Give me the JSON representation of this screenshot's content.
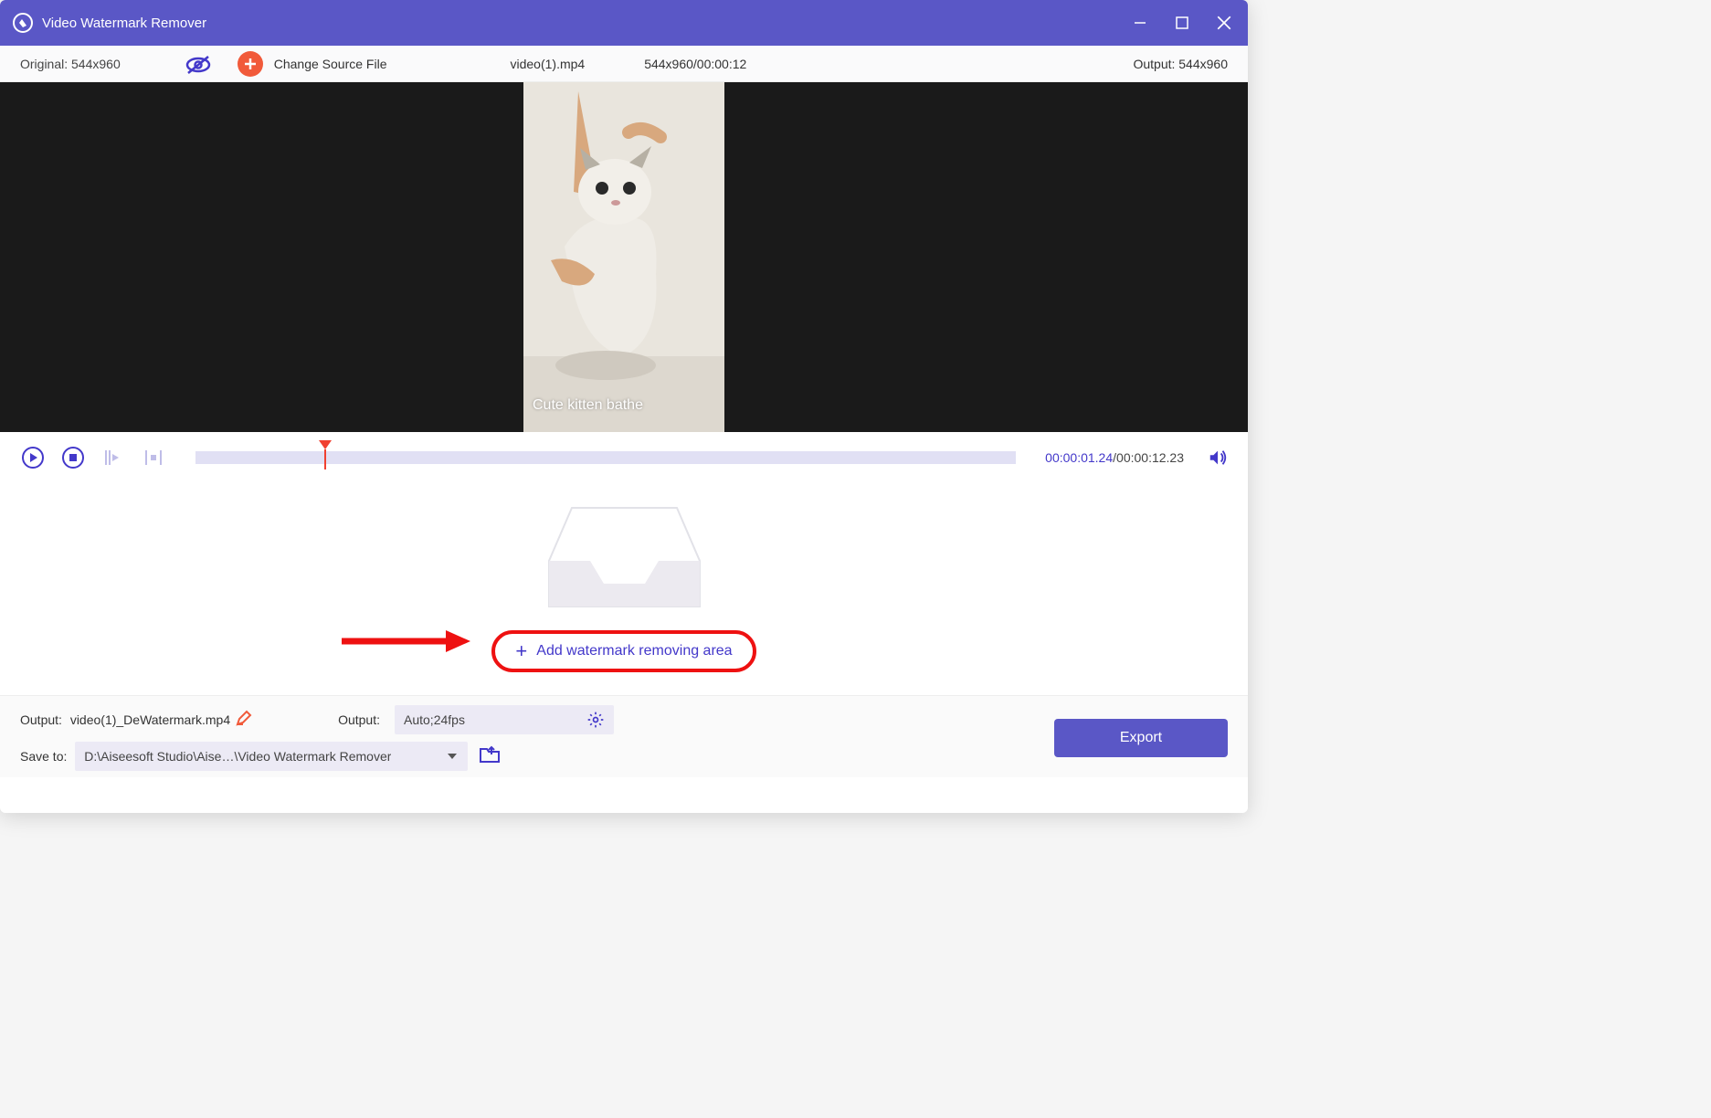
{
  "window": {
    "title": "Video Watermark Remover"
  },
  "infobar": {
    "original_label": "Original: 544x960",
    "change_source_label": "Change Source File",
    "filename": "video(1).mp4",
    "dimensions_time": "544x960/00:00:12",
    "output_label": "Output: 544x960"
  },
  "video": {
    "watermark_text": "Cute kitten bathe"
  },
  "player": {
    "current_time": "00:00:01.24",
    "total_time": "/00:00:12.23",
    "progress_percent": 15
  },
  "dropzone": {
    "button_label": "Add watermark removing area"
  },
  "bottom": {
    "output_label": "Output:",
    "output_filename": "video(1)_DeWatermark.mp4",
    "format_label": "Output:",
    "format_value": "Auto;24fps",
    "save_label": "Save to:",
    "save_path": "D:\\Aiseesoft Studio\\Aise…\\Video Watermark Remover",
    "export_label": "Export"
  }
}
